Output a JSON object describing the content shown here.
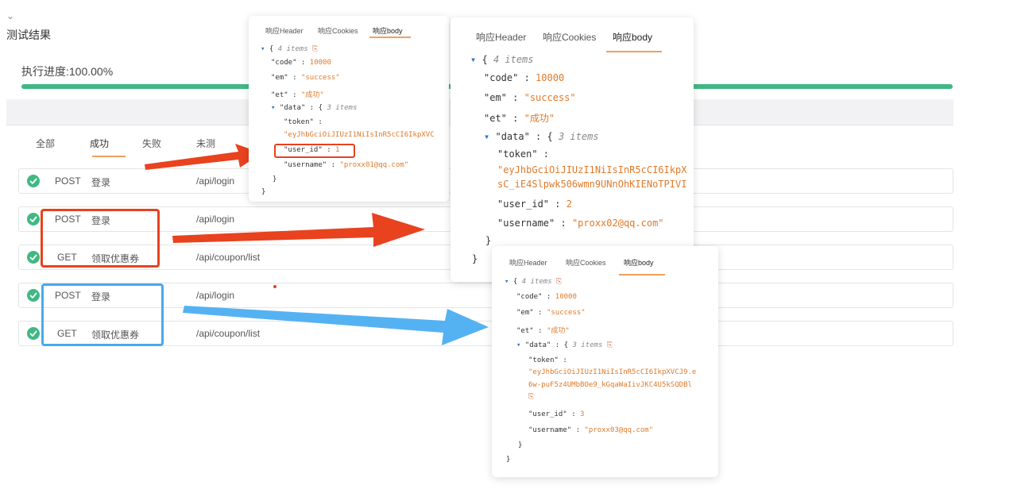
{
  "page": {
    "chevron_icon": "chevron-down-icon",
    "title": "测试结果",
    "progress_label": "执行进度:100.00%",
    "progress_value": 1.0,
    "accent_green": "#41b883",
    "tabs": [
      {
        "label": "全部"
      },
      {
        "label": "成功"
      },
      {
        "label": "失败"
      },
      {
        "label": "未测"
      }
    ],
    "rows": [
      {
        "method": "POST",
        "name": "登录",
        "path": "/api/login"
      },
      {
        "method": "POST",
        "name": "登录",
        "path": "/api/login"
      },
      {
        "method": "GET",
        "name": "领取优惠券",
        "path": "/api/coupon/list"
      },
      {
        "method": "POST",
        "name": "登录",
        "path": "/api/login"
      },
      {
        "method": "GET",
        "name": "领取优惠券",
        "path": "/api/coupon/list"
      }
    ]
  },
  "annotations": {
    "red_color": "#e8421f",
    "blue_color": "#4aa8ef"
  },
  "popups": {
    "tab_labels": {
      "header": "响应Header",
      "cookies": "响应Cookies",
      "body": "响应body"
    },
    "p1": {
      "items": "4 items",
      "data_items": "3 items",
      "code": "10000",
      "em": "\"success\"",
      "et": "\"成功\"",
      "token": "\"eyJhbGciOiJIUzI1NiIsInR5cCI6IkpXVC",
      "user_id": "1",
      "username": "\"proxx01@qq.com\""
    },
    "p2": {
      "items": "4 items",
      "data_items": "3 items",
      "code": "10000",
      "em": "\"success\"",
      "et": "\"成功\"",
      "token_line1": "\"eyJhbGciOiJIUzI1NiIsInR5cCI6IkpX",
      "token_line2": "sC_iE4Slpwk506wmn9UNnOhKIENoTPIVI",
      "user_id": "2",
      "username": "\"proxx02@qq.com\""
    },
    "p3": {
      "items": "4 items",
      "data_items": "3 items",
      "code": "10000",
      "em": "\"success\"",
      "et": "\"成功\"",
      "token_line1": "\"eyJhbGciOiJIUzI1NiIsInR5cCI6IkpXVCJ9.e",
      "token_line2": "6w-puF5z4UMbBOe9_kGqaWaIivJKC4U5kSQDBl",
      "user_id": "3",
      "username": "\"proxx03@qq.com\""
    },
    "keys": {
      "code": "\"code\"",
      "em": "\"em\"",
      "et": "\"et\"",
      "data": "\"data\"",
      "token": "\"token\"",
      "user_id": "\"user_id\"",
      "username": "\"username\""
    }
  }
}
